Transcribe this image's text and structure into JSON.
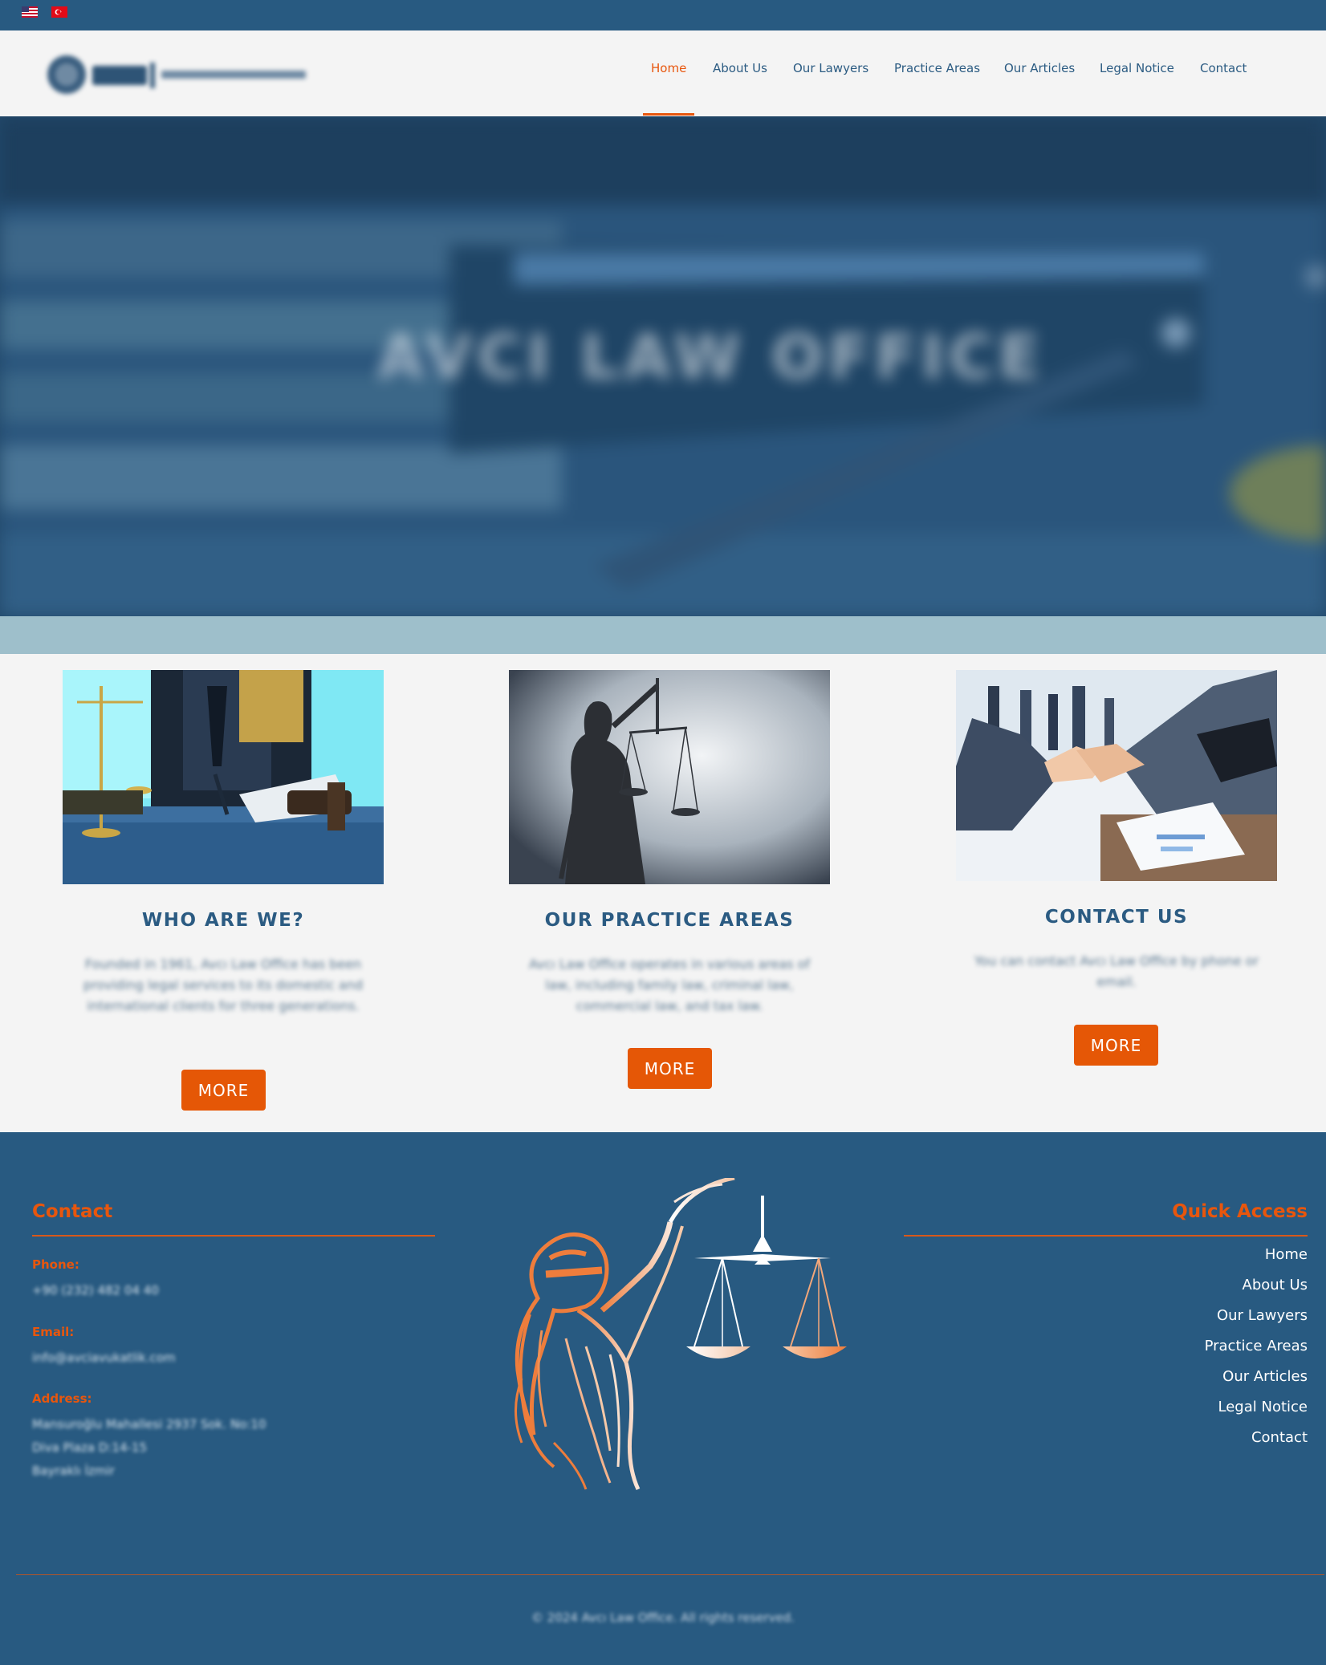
{
  "topbar": {
    "flags": [
      {
        "icon": "us-flag-icon"
      },
      {
        "icon": "turkey-flag-icon"
      }
    ]
  },
  "header": {
    "logo_text": "AVCI LAW OFFICE",
    "nav": [
      {
        "label": "Home",
        "active": true
      },
      {
        "label": "About Us",
        "active": false
      },
      {
        "label": "Our Lawyers",
        "active": false
      },
      {
        "label": "Practice Areas",
        "active": false
      },
      {
        "label": "Our Articles",
        "active": false
      },
      {
        "label": "Legal Notice",
        "active": false
      },
      {
        "label": "Contact",
        "active": false
      }
    ]
  },
  "hero": {
    "title": "AVCI LAW OFFICE"
  },
  "cards": [
    {
      "title": "WHO ARE WE?",
      "text": "Founded in 1961, Avcı Law Office has been providing legal services to its domestic and international clients for three generations.",
      "button": "MORE"
    },
    {
      "title": "OUR PRACTICE AREAS",
      "text": "Avcı Law Office operates in various areas of law, including family law, criminal law, commercial law, and tax law.",
      "button": "MORE"
    },
    {
      "title": "CONTACT US",
      "text": "You can contact Avcı Law Office by phone or email.",
      "button": "MORE"
    }
  ],
  "footer": {
    "contact_heading": "Contact",
    "phone_label": "Phone:",
    "phone_value": "+90 (232) 482 04 40",
    "email_label": "Email:",
    "email_value": "info@avciavukatlik.com",
    "address_label": "Address:",
    "address_lines": [
      "Mansuroğlu Mahallesi 2937 Sok. No:10",
      "Diva Plaza D:14-15",
      "Bayraklı İzmir"
    ],
    "quick_heading": "Quick Access",
    "quick_links": [
      "Home",
      "About Us",
      "Our Lawyers",
      "Practice Areas",
      "Our Articles",
      "Legal Notice",
      "Contact"
    ],
    "copyright": "© 2024 Avcı Law Office. All rights reserved."
  },
  "colors": {
    "brand_blue": "#285a81",
    "accent_orange": "#e55706",
    "band": "#9ebfcb"
  }
}
